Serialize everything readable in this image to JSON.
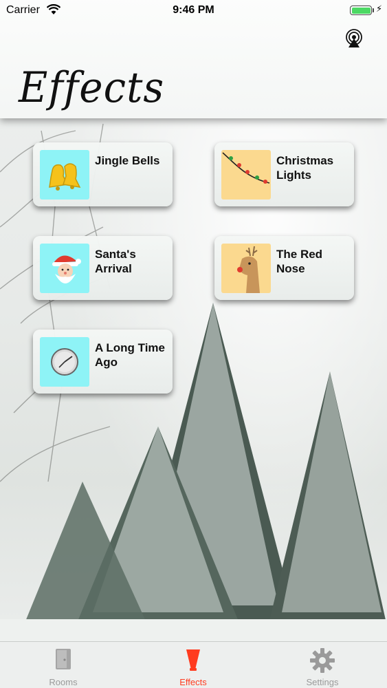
{
  "status_bar": {
    "carrier": "Carrier",
    "time": "9:46 PM"
  },
  "header": {
    "title": "Effects",
    "airplay_icon": "airplay-icon"
  },
  "effects": [
    {
      "label": "Jingle Bells",
      "icon": "bells-icon",
      "thumb_color": "#8ef3f6"
    },
    {
      "label": "Christmas Lights",
      "icon": "string-lights-icon",
      "thumb_color": "#fbd98f"
    },
    {
      "label": "Santa's Arrival",
      "icon": "santa-icon",
      "thumb_color": "#8ef3f6"
    },
    {
      "label": "The Red Nose",
      "icon": "reindeer-icon",
      "thumb_color": "#fbd98f"
    },
    {
      "label": "A Long Time Ago",
      "icon": "clock-icon",
      "thumb_color": "#8ef3f6"
    }
  ],
  "tabbar": {
    "tabs": [
      {
        "label": "Rooms",
        "icon": "door-icon",
        "active": false
      },
      {
        "label": "Effects",
        "icon": "cone-icon",
        "active": true
      },
      {
        "label": "Settings",
        "icon": "gear-icon",
        "active": false
      }
    ],
    "active_color": "#ff3b1f",
    "inactive_color": "#9a9a9a"
  }
}
